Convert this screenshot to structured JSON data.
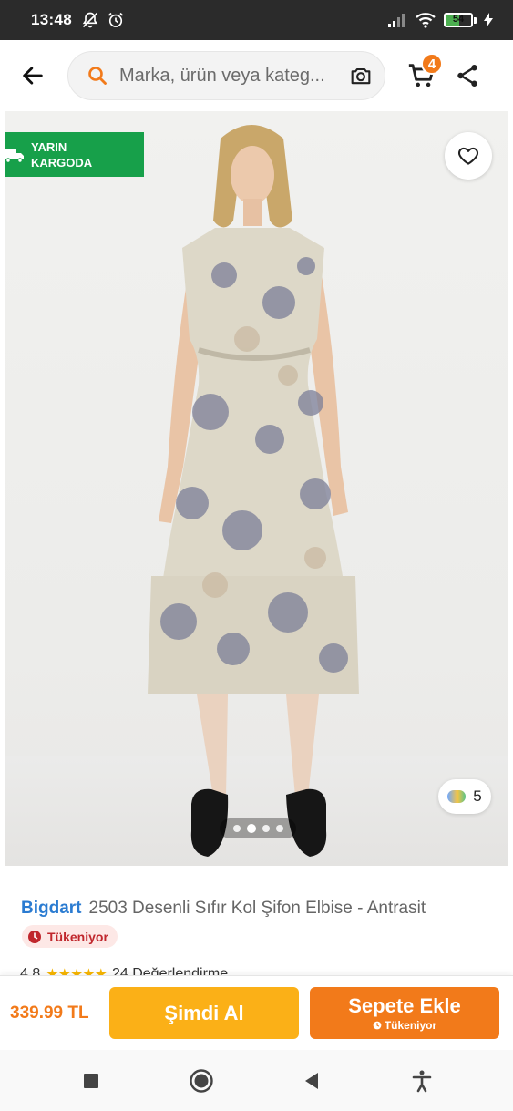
{
  "status_bar": {
    "time": "13:48",
    "battery_level": "54",
    "battery_fraction": 0.54
  },
  "app_bar": {
    "search_placeholder": "Marka, ürün veya kateg...",
    "cart_count": "4"
  },
  "gallery": {
    "shipping_badge_line1": "YARIN",
    "shipping_badge_line2": "KARGODA",
    "color_count": "5",
    "image_count": 4,
    "active_image_index": 1
  },
  "product": {
    "brand": "Bigdart",
    "name": "2503 Desenli Sıfır Kol Şifon Elbise - Antrasit",
    "stock_label": "Tükeniyor",
    "rating": "4.8",
    "rating_stars": 5,
    "review_text": "24 Değerlendirme"
  },
  "action_bar": {
    "price": "339.99 TL",
    "buy_now_label": "Şimdi Al",
    "add_to_cart_label": "Sepete Ekle",
    "add_to_cart_sub": "Tükeniyor"
  },
  "colors": {
    "accent": "#f27a1a",
    "buy_now": "#fbb017",
    "shipping_green": "#17a04a",
    "brand_blue": "#2a7bd1",
    "stock_red": "#c0272d"
  },
  "icons": [
    "back-arrow-icon",
    "search-icon",
    "camera-icon",
    "cart-icon",
    "share-icon",
    "truck-icon",
    "heart-icon",
    "clock-icon",
    "recents-icon",
    "home-icon",
    "back-nav-icon",
    "accessibility-icon"
  ]
}
